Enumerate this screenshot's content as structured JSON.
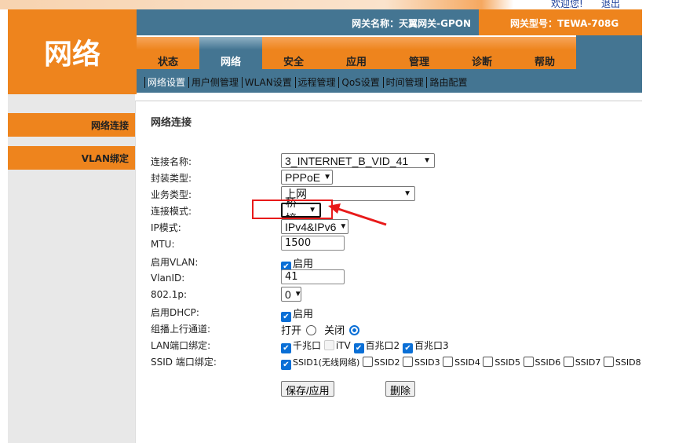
{
  "header": {
    "welcome": "欢迎您!",
    "logout": "退出",
    "section_title": "网络",
    "gateway_name": "网关名称：天翼网关-GPON",
    "gateway_model": "网关型号：TEWA-708G"
  },
  "tabs": [
    {
      "label": "状态"
    },
    {
      "label": "网络",
      "active": true
    },
    {
      "label": "安全"
    },
    {
      "label": "应用"
    },
    {
      "label": "管理"
    },
    {
      "label": "诊断"
    },
    {
      "label": "帮助"
    }
  ],
  "subnav": [
    {
      "label": "网络设置",
      "active": true
    },
    {
      "label": "用户侧管理"
    },
    {
      "label": "WLAN设置"
    },
    {
      "label": "远程管理"
    },
    {
      "label": "QoS设置"
    },
    {
      "label": "时间管理"
    },
    {
      "label": "路由配置"
    }
  ],
  "sidebar": [
    {
      "label": "网络连接"
    },
    {
      "label": "VLAN绑定"
    }
  ],
  "form": {
    "title": "网络连接",
    "conn_name": {
      "label": "连接名称:",
      "value": "3_INTERNET_B_VID_41"
    },
    "encap": {
      "label": "封装类型:",
      "value": "PPPoE"
    },
    "service": {
      "label": "业务类型:",
      "value": "上网"
    },
    "mode": {
      "label": "连接模式:",
      "value": "桥接"
    },
    "ip_mode": {
      "label": "IP模式:",
      "value": "IPv4&IPv6"
    },
    "mtu": {
      "label": "MTU:",
      "value": "1500"
    },
    "vlan_enable": {
      "label": "启用VLAN:",
      "text": "启用",
      "checked": true
    },
    "vlan_id": {
      "label": "VlanID:",
      "value": "41"
    },
    "p8021": {
      "label": "802.1p:",
      "value": "0"
    },
    "dhcp": {
      "label": "启用DHCP:",
      "text": "启用",
      "checked": true
    },
    "multicast": {
      "label": "组播上行通道:",
      "on": "打开",
      "off": "关闭",
      "selected": "关闭"
    },
    "lan_bind": {
      "label": "LAN端口绑定:",
      "ports": [
        {
          "label": "千兆口",
          "checked": true
        },
        {
          "label": "iTV",
          "checked": false,
          "disabled": true
        },
        {
          "label": "百兆口2",
          "checked": true
        },
        {
          "label": "百兆口3",
          "checked": true
        }
      ]
    },
    "ssid_bind": {
      "label": "SSID 端口绑定:",
      "ssids": [
        {
          "label": "SSID1(无线网络)",
          "checked": true
        },
        {
          "label": "SSID2",
          "checked": false
        },
        {
          "label": "SSID3",
          "checked": false
        },
        {
          "label": "SSID4",
          "checked": false
        },
        {
          "label": "SSID5",
          "checked": false
        },
        {
          "label": "SSID6",
          "checked": false
        },
        {
          "label": "SSID7",
          "checked": false
        },
        {
          "label": "SSID8",
          "checked": false
        }
      ]
    },
    "save": "保存/应用",
    "delete": "删除"
  },
  "annotation_color": "#e81a1a"
}
